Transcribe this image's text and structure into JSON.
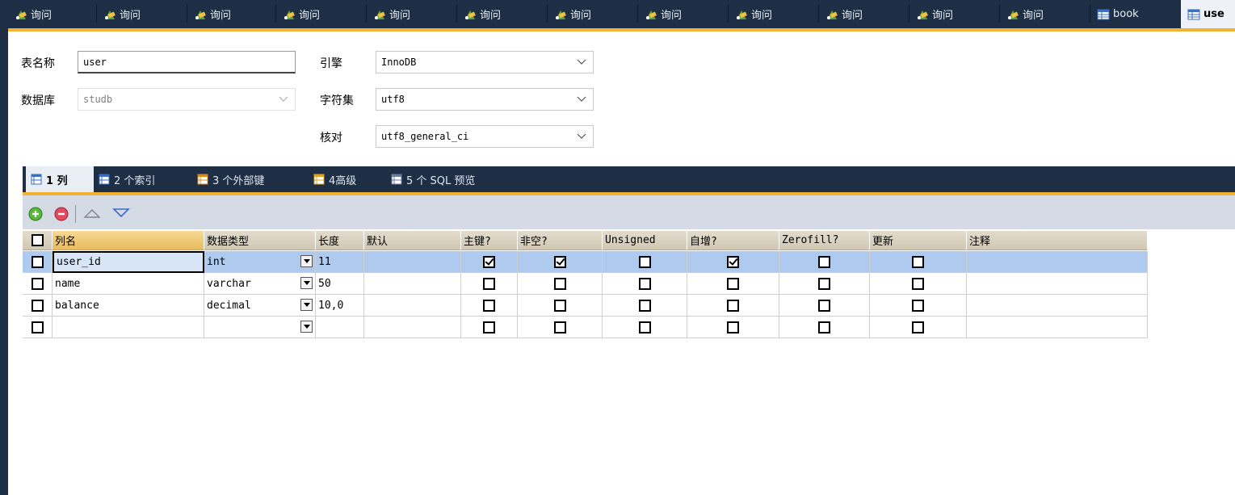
{
  "colors": {
    "dark": "#1e2e44",
    "accent": "#f2b233",
    "row_selected": "#aecbef"
  },
  "top_tabs": [
    {
      "label": "询问",
      "icon": "query-icon"
    },
    {
      "label": "询问",
      "icon": "query-icon"
    },
    {
      "label": "询问",
      "icon": "query-icon"
    },
    {
      "label": "询问",
      "icon": "query-icon"
    },
    {
      "label": "询问",
      "icon": "query-icon"
    },
    {
      "label": "询问",
      "icon": "query-icon"
    },
    {
      "label": "询问",
      "icon": "query-icon"
    },
    {
      "label": "询问",
      "icon": "query-icon"
    },
    {
      "label": "询问",
      "icon": "query-icon"
    },
    {
      "label": "询问",
      "icon": "query-icon"
    },
    {
      "label": "询问",
      "icon": "query-icon"
    },
    {
      "label": "询问",
      "icon": "query-icon"
    },
    {
      "label": "book",
      "icon": "table-icon"
    },
    {
      "label": "use",
      "icon": "table-edit-icon"
    }
  ],
  "form": {
    "table_name_label": "表名称",
    "table_name_value": "user",
    "database_label": "数据库",
    "database_value": "studb",
    "engine_label": "引擎",
    "engine_value": "InnoDB",
    "charset_label": "字符集",
    "charset_value": "utf8",
    "collation_label": "核对",
    "collation_value": "utf8_general_ci"
  },
  "sub_tabs": [
    {
      "label": "1 列",
      "icon": "columns-icon"
    },
    {
      "label": "2 个索引",
      "icon": "index-icon"
    },
    {
      "label": "3 个外部键",
      "icon": "foreign-key-icon"
    },
    {
      "label": "4高级",
      "icon": "advanced-icon"
    },
    {
      "label": "5 个 SQL 预览",
      "icon": "sql-preview-icon"
    }
  ],
  "toolbar": [
    "add-column-icon",
    "remove-column-icon",
    "move-up-icon",
    "move-down-icon"
  ],
  "grid": {
    "headers": [
      "列名",
      "数据类型",
      "长度",
      "默认",
      "主键?",
      "非空?",
      "Unsigned",
      "自增?",
      "Zerofill?",
      "更新",
      "注释"
    ],
    "rows": [
      {
        "name": "user_id",
        "type": "int",
        "length": "11",
        "default": "",
        "pk": true,
        "nn": true,
        "unsigned": false,
        "ai": true,
        "zerofill": false,
        "update": false,
        "comment": ""
      },
      {
        "name": "name",
        "type": "varchar",
        "length": "50",
        "default": "",
        "pk": false,
        "nn": false,
        "unsigned": false,
        "ai": false,
        "zerofill": false,
        "update": false,
        "comment": ""
      },
      {
        "name": "balance",
        "type": "decimal",
        "length": "10,0",
        "default": "",
        "pk": false,
        "nn": false,
        "unsigned": false,
        "ai": false,
        "zerofill": false,
        "update": false,
        "comment": ""
      },
      {
        "name": "",
        "type": "",
        "length": "",
        "default": "",
        "pk": false,
        "nn": false,
        "unsigned": false,
        "ai": false,
        "zerofill": false,
        "update": false,
        "comment": ""
      }
    ]
  }
}
